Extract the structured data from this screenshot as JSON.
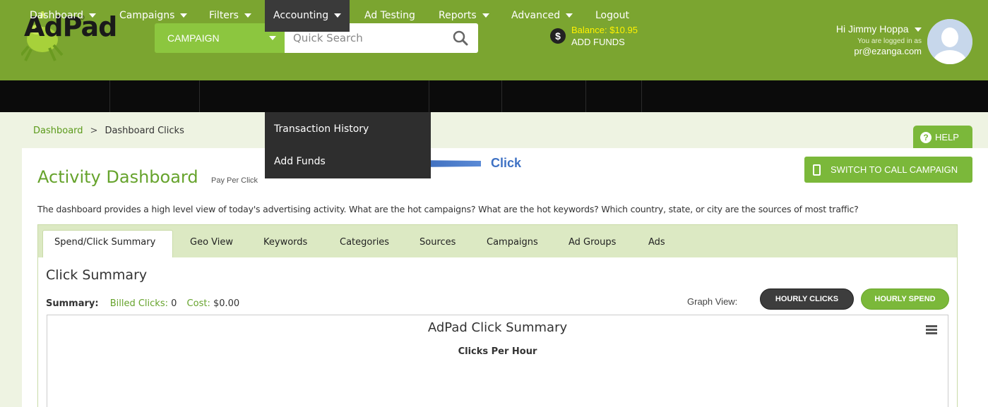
{
  "header": {
    "logo_text": "AdPad",
    "logo_reg": "®",
    "campaign_select": "CAMPAIGN",
    "search_placeholder": "Quick Search",
    "balance_icon": "$",
    "balance": "Balance: $10.95",
    "add_funds": "ADD FUNDS",
    "greeting": "Hi Jimmy Hoppa",
    "login_status": "You are logged in as",
    "email": "pr@ezanga.com"
  },
  "nav": {
    "items": [
      {
        "label": "Dashboard"
      },
      {
        "label": "Campaigns"
      },
      {
        "label": "Filters"
      },
      {
        "label": "Accounting"
      },
      {
        "label": "Ad Testing"
      },
      {
        "label": "Reports"
      },
      {
        "label": "Advanced"
      },
      {
        "label": "Logout"
      }
    ]
  },
  "dropdown": {
    "items": [
      "Transaction History",
      "Add Funds"
    ]
  },
  "breadcrumb": {
    "root": "Dashboard",
    "separator": ">",
    "current": "Dashboard Clicks"
  },
  "help": {
    "icon": "?",
    "label": "HELP"
  },
  "page": {
    "title": "Activity Dashboard",
    "subtitle": "Pay Per Click",
    "switch_button": "SWITCH TO CALL CAMPAIGN",
    "description": "The dashboard provides a high level view of today's advertising activity. What are the hot campaigns? What are the hot keywords? Which country, state, or city are the sources of most traffic?"
  },
  "tabs": [
    "Spend/Click Summary",
    "Geo View",
    "Keywords",
    "Categories",
    "Sources",
    "Campaigns",
    "Ad Groups",
    "Ads"
  ],
  "summary": {
    "section_title": "Click Summary",
    "label": "Summary:",
    "billed_label": "Billed Clicks:",
    "billed_value": "0",
    "cost_label": "Cost:",
    "cost_value": "$0.00",
    "graph_view": "Graph View:",
    "hourly_clicks": "HOURLY CLICKS",
    "hourly_spend": "HOURLY SPEND"
  },
  "chart": {
    "title": "AdPad Click Summary",
    "subtitle": "Clicks Per Hour"
  },
  "annotation": {
    "label": "Click",
    "color": "#3f72c4"
  },
  "colors": {
    "header_green": "#7ba530",
    "accent_green": "#7bb83a",
    "nav_black": "#0b0b0b",
    "balance_yellow": "#fff200"
  }
}
